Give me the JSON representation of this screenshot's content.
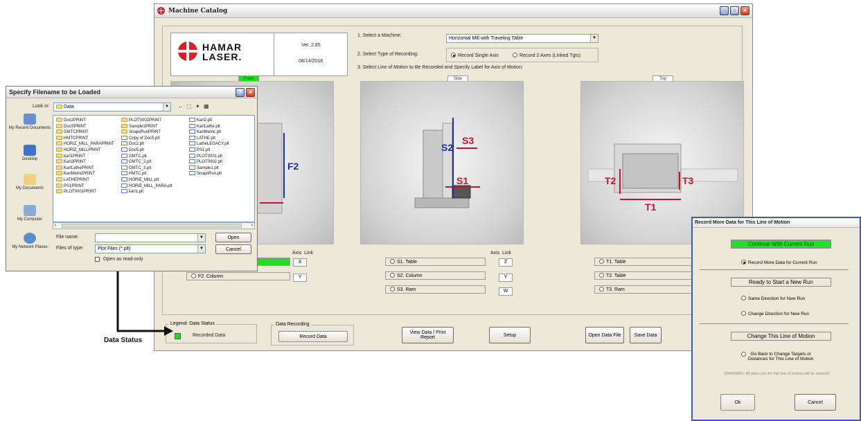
{
  "main_window": {
    "title": "Machine Catalog",
    "version": "Ver. 2.85",
    "date": "08/14/2018",
    "logo_text_line1": "HAMAR",
    "logo_text_line2": "LASER."
  },
  "steps": {
    "select_machine_label": "1. Select a Machine:",
    "machine_value": "Horizontal Mill with Traveling Table",
    "recording_type_label": "2. Select Type of Recording:",
    "record_single": "Record Single Axis",
    "record_two": "Record 2 Axes (Linked Tgts)",
    "line_of_motion_label": "3. Select Line of Motion to Be Recorded and Specify Label for Axis of Motion:"
  },
  "views": {
    "front": {
      "tab": "Front",
      "labels": [
        "F2"
      ]
    },
    "side": {
      "tab": "Side",
      "labels": [
        "S2",
        "S3",
        "S1"
      ]
    },
    "top": {
      "tab": "Top",
      "labels": [
        "T2",
        "T3",
        "T1"
      ]
    }
  },
  "axis_headers": {
    "axis": "Axis",
    "link": "Link"
  },
  "front_axes": [
    {
      "label": "",
      "value": "X"
    },
    {
      "label": "F2. Column",
      "value": "Y"
    }
  ],
  "side_axes": [
    {
      "label": "S1. Table",
      "value": "Z"
    },
    {
      "label": "S2. Column",
      "value": "Y"
    },
    {
      "label": "S3. Ram",
      "value": "W"
    }
  ],
  "top_axes": [
    {
      "label": "T1. Table"
    },
    {
      "label": "T2. Table"
    },
    {
      "label": "T3. Ram"
    }
  ],
  "legend": {
    "caption": "Legend: Data Status",
    "recorded": "Recorded Data"
  },
  "data_recording": {
    "caption": "Data Recording",
    "record_button": "Record Data"
  },
  "buttons": {
    "view_data": "View Data / Print Report",
    "setup": "Setup",
    "open_data_file": "Open Data File",
    "save_data": "Save Data"
  },
  "annotation": {
    "data_status": "Data Status"
  },
  "file_dialog": {
    "title": "Specify Filename to be Loaded",
    "look_in_label": "Look in:",
    "look_in_value": "Data",
    "places": [
      "My Recent Documents",
      "Desktop",
      "My Documents",
      "My Computer",
      "My Network Places"
    ],
    "col1": [
      "Doc2PRINT",
      "DocSPRINT",
      "GMTCPRINT",
      "HMTCPRINT",
      "HORIZ_MILL_PARAPRINT",
      "HORIZ_MILLPRINT",
      "karl1PRINT",
      "Karl2PRINT",
      "KarlLathePRINT",
      "KarlMetricPRINT",
      "LATHEPRINT",
      "PS1PRINT",
      "PLOT0001PRINT"
    ],
    "col2": [
      "PLOT0002PRINT",
      "Sample1PRINT",
      "SnapsRunPRINT",
      "Copy of Doc5.plt",
      "Doc2.plt",
      "Doc5.plt",
      "GMTC.plt",
      "GMTC_2.plt",
      "GMTC_3.plt",
      "HMTC.plt",
      "HORIZ_MILL.plt",
      "HORIZ_MILL_PARA.plt",
      "karl1.plt"
    ],
    "col3": [
      "Karl2.plt",
      "KarlLathe.plt",
      "KarlMetric.plt",
      "LATHE.plt",
      "LatheLEGACY.plt",
      "PS1.plt",
      "PLOT0001.plt",
      "PLOT0002.plt",
      "Sample1.plt",
      "SnapsRun.plt"
    ],
    "file_name_label": "File name:",
    "file_name_value": "",
    "files_of_type_label": "Files of type:",
    "files_of_type_value": "Plot Files (*.plt)",
    "read_only_label": "Open as read-only",
    "open_button": "Open",
    "cancel_button": "Cancel"
  },
  "run_dialog": {
    "title": "Record More Data for This Line of Motion",
    "continue_header": "Continue With Current Run",
    "record_more": "Record More Data for Current Run",
    "ready_header": "Ready to Start a New Run",
    "same_direction": "Same Direction for New Run",
    "change_direction": "Change Direction for New Run",
    "change_header": "Change This Line of Motion",
    "go_back_line1": "Go Back to Change Targets or",
    "go_back_line2": "Distances for This Line of Motion",
    "warning": "(WARNING: All data runs for this line of motion will be erased!)",
    "ok_button": "Ok",
    "cancel_button": "Cancel"
  },
  "colors": {
    "green_status": "#22dd22",
    "accent_red": "#d9202a",
    "dialog_border": "#3d55c6",
    "axis_label": "#c8102e",
    "axis_label_blue": "#1c2aa8"
  }
}
